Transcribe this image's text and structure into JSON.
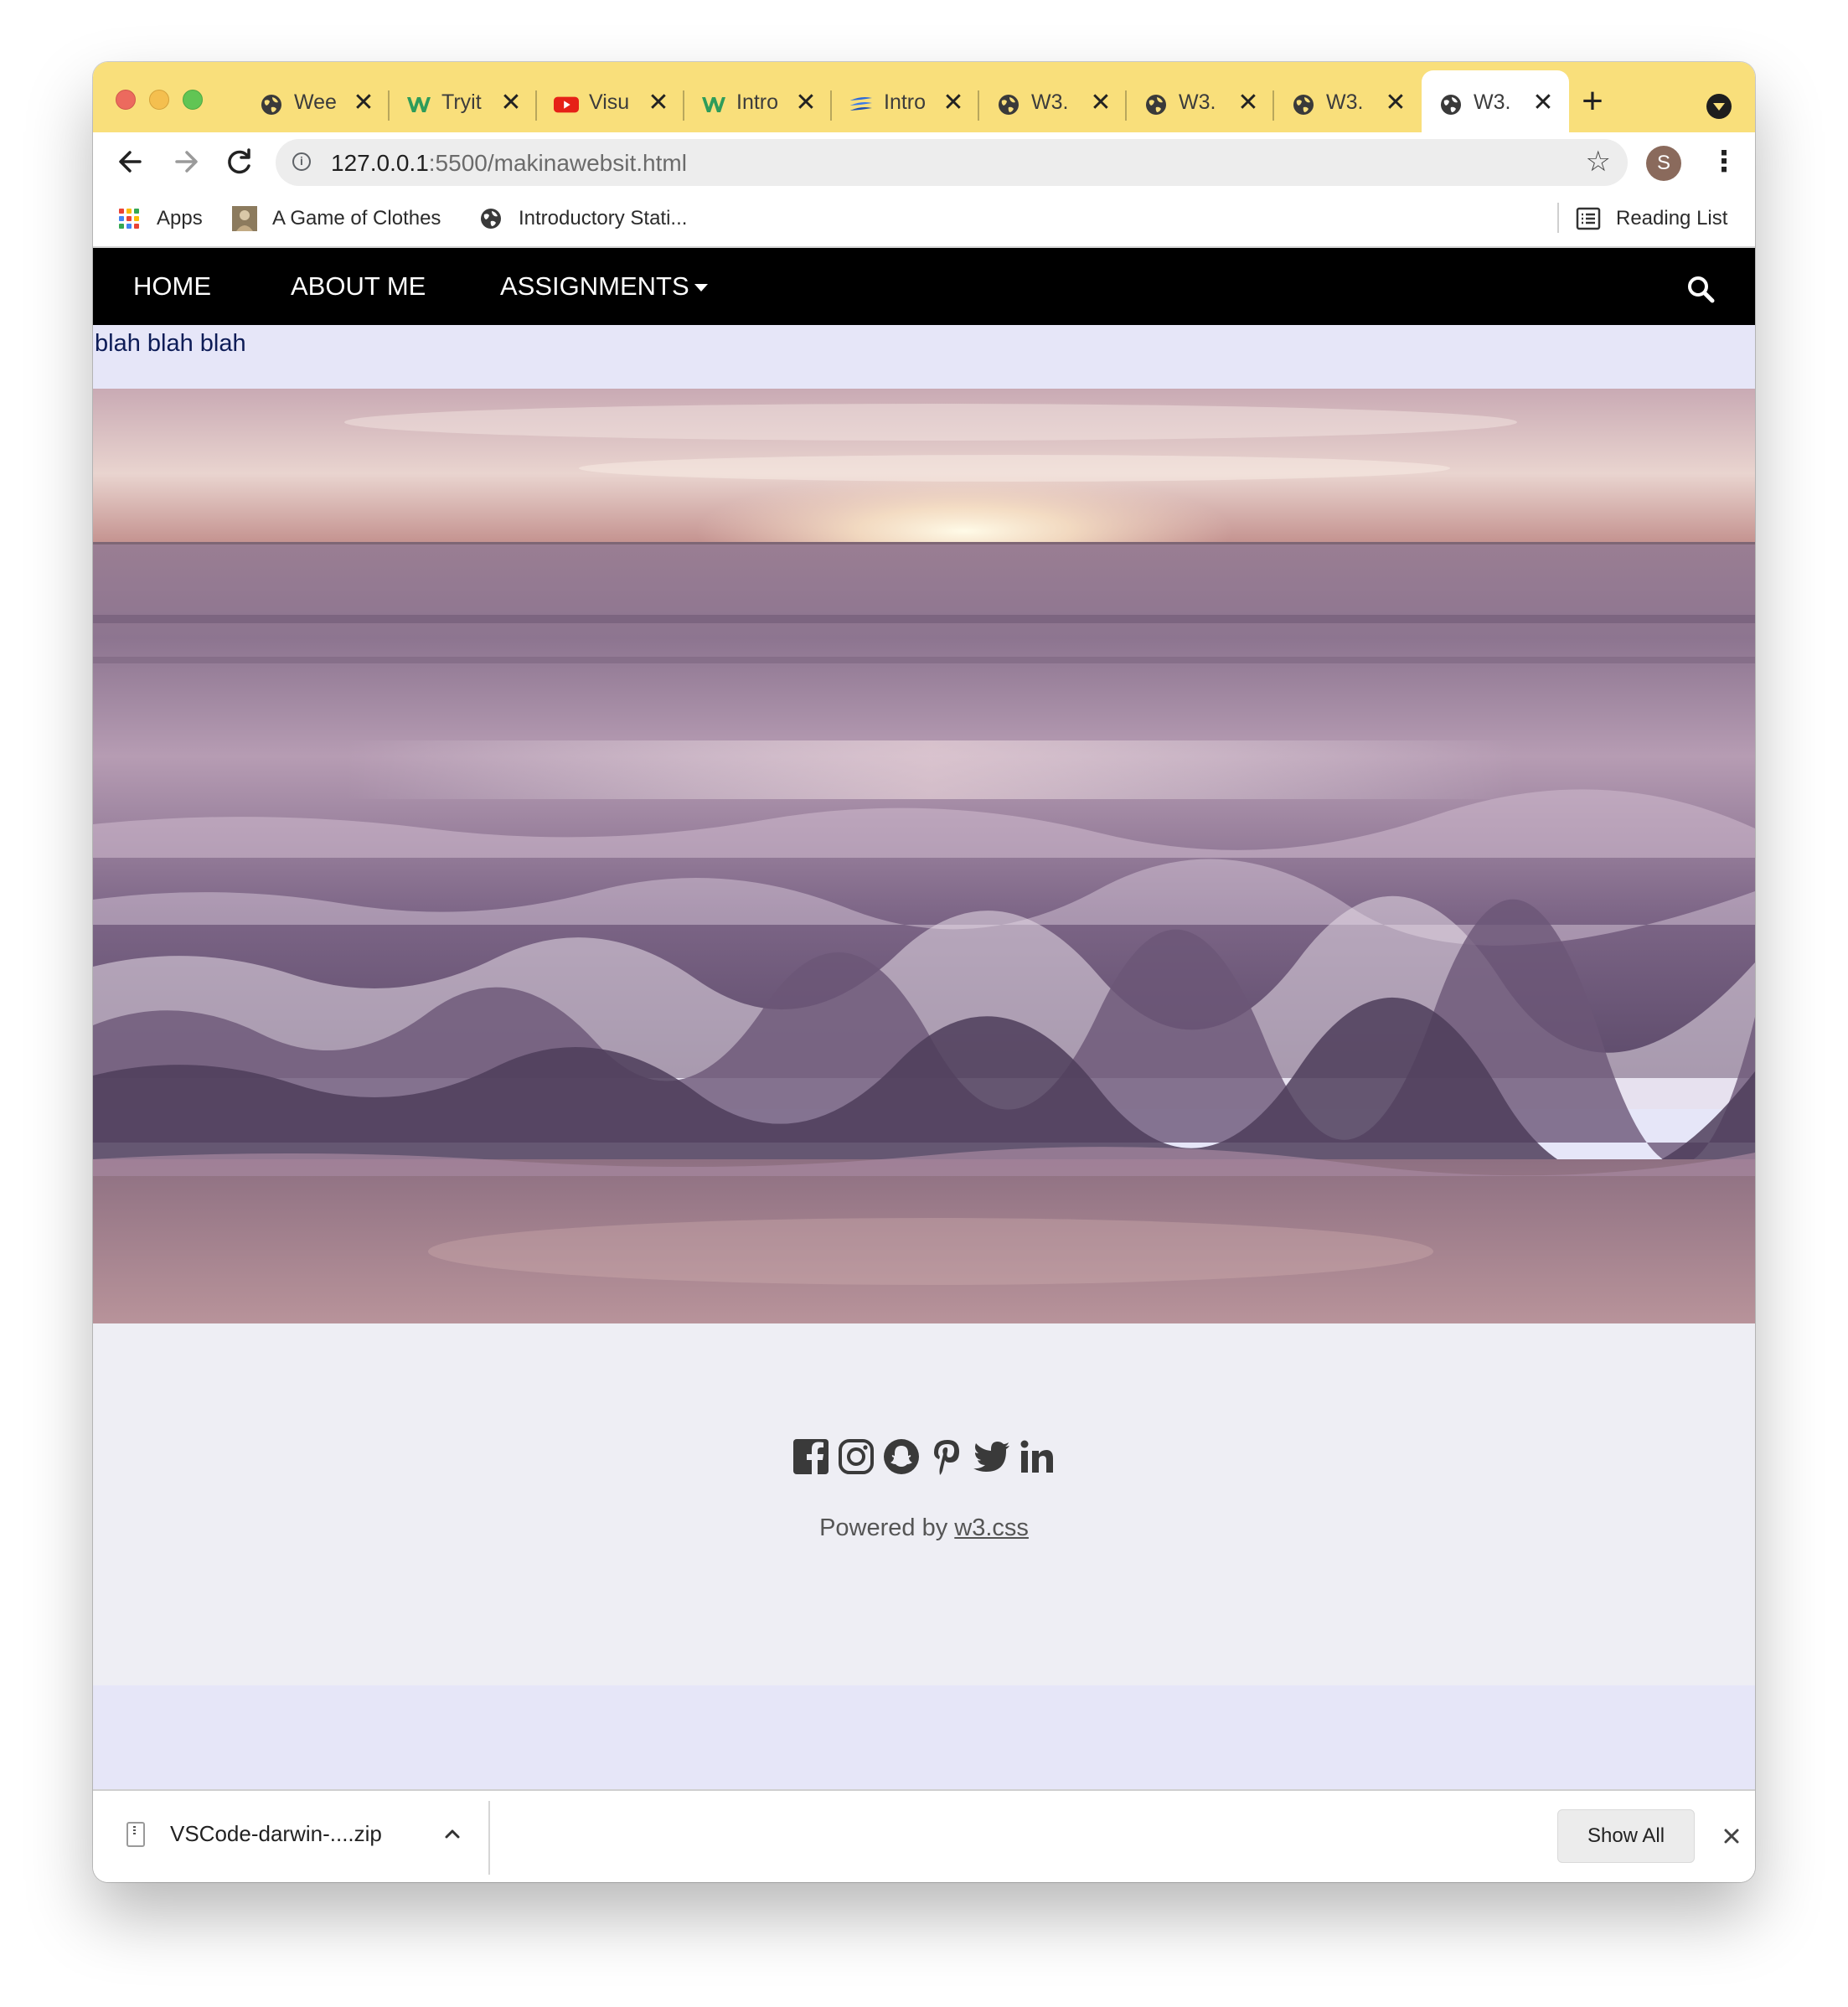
{
  "browser": {
    "tabs": [
      {
        "title": "Wee",
        "favicon": "globe-icon"
      },
      {
        "title": "Tryit",
        "favicon": "w3schools-icon"
      },
      {
        "title": "Visu",
        "favicon": "youtube-icon"
      },
      {
        "title": "Intro",
        "favicon": "w3schools-icon"
      },
      {
        "title": "Intro",
        "favicon": "swoosh-icon"
      },
      {
        "title": "W3.",
        "favicon": "globe-icon"
      },
      {
        "title": "W3.",
        "favicon": "globe-icon"
      },
      {
        "title": "W3.",
        "favicon": "globe-icon"
      },
      {
        "title": "W3.",
        "favicon": "globe-icon",
        "active": true
      }
    ],
    "tab_close_glyph": "✕",
    "new_tab_glyph": "+",
    "tab_strip_color": "#f9df7b",
    "address": {
      "host": "127.0.0.1",
      "rest": ":5500/makinawebsit.html"
    },
    "profile_initial": "S",
    "bookmarks": {
      "apps": "Apps",
      "items": [
        {
          "label": "A Game of Clothes"
        },
        {
          "label": "Introductory Stati..."
        }
      ],
      "reading_list": "Reading List"
    }
  },
  "site": {
    "nav": {
      "home": "HOME",
      "about": "ABOUT ME",
      "assignments": "ASSIGNMENTS"
    },
    "body_text": "blah blah blah",
    "hero_image": "ocean-waves-at-sunset",
    "footer": {
      "socials": [
        "facebook-icon",
        "instagram-icon",
        "snapchat-icon",
        "pinterest-icon",
        "twitter-icon",
        "linkedin-icon"
      ],
      "powered_prefix": "Powered by ",
      "powered_link": "w3.css"
    },
    "colors": {
      "nav_bg": "#000000",
      "page_bg": "#e6e6f8",
      "footer_bg": "#eeeef4",
      "text_blue": "#0d1c57"
    }
  },
  "downloads": {
    "filename": "VSCode-darwin-....zip",
    "show_all": "Show All"
  }
}
